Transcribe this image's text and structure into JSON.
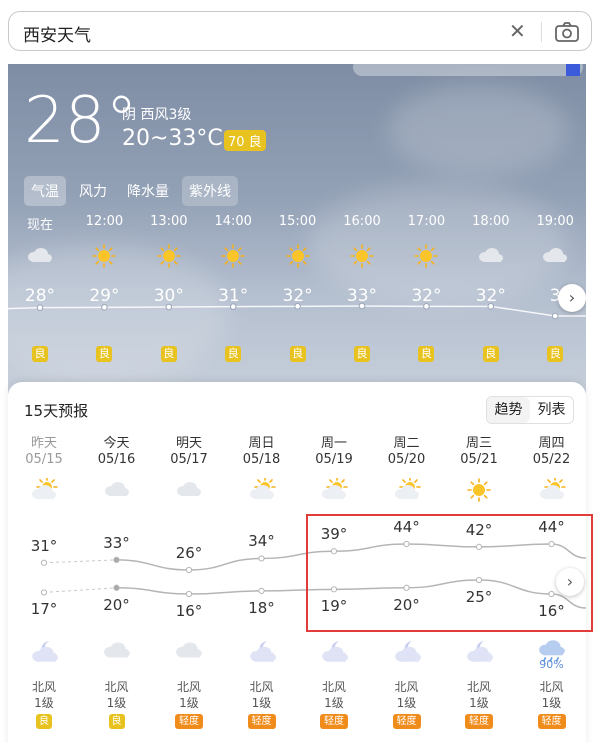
{
  "search": {
    "query": "西安天气"
  },
  "current": {
    "temp": "28°",
    "condition": "阴 西风3级",
    "range": "20~33°C",
    "aqi": "70 良"
  },
  "tabs": [
    "气温",
    "风力",
    "降水量",
    "紫外线"
  ],
  "hourly": [
    {
      "time": "现在",
      "icon": "cloud-icon",
      "temp": "28°",
      "aqi": "良"
    },
    {
      "time": "12:00",
      "icon": "sun-icon",
      "temp": "29°",
      "aqi": "良"
    },
    {
      "time": "13:00",
      "icon": "sun-icon",
      "temp": "30°",
      "aqi": "良"
    },
    {
      "time": "14:00",
      "icon": "sun-icon",
      "temp": "31°",
      "aqi": "良"
    },
    {
      "time": "15:00",
      "icon": "sun-icon",
      "temp": "32°",
      "aqi": "良"
    },
    {
      "time": "16:00",
      "icon": "sun-icon",
      "temp": "33°",
      "aqi": "良"
    },
    {
      "time": "17:00",
      "icon": "sun-icon",
      "temp": "32°",
      "aqi": "良"
    },
    {
      "time": "18:00",
      "icon": "cloud-icon",
      "temp": "32°",
      "aqi": "良"
    },
    {
      "time": "19:00",
      "icon": "cloud-icon",
      "temp": "3",
      "aqi": "良"
    }
  ],
  "forecast": {
    "title": "15天预报",
    "view_trend": "趋势",
    "view_list": "列表",
    "days": [
      {
        "name": "昨天",
        "date": "05/15",
        "icon": "partly-cloudy-icon",
        "hi": "31°",
        "lo": "17°",
        "night": "moon-cloud-icon",
        "precip": "",
        "wind": "北风",
        "level": "1级",
        "aqi": "良",
        "aqi_color": "#e8c21f",
        "past": true
      },
      {
        "name": "今天",
        "date": "05/16",
        "icon": "cloud-icon",
        "hi": "33°",
        "lo": "20°",
        "night": "cloud-icon",
        "precip": "",
        "wind": "北风",
        "level": "1级",
        "aqi": "良",
        "aqi_color": "#e8c21f",
        "past": false
      },
      {
        "name": "明天",
        "date": "05/17",
        "icon": "cloud-icon",
        "hi": "26°",
        "lo": "16°",
        "night": "cloud-icon",
        "precip": "",
        "wind": "北风",
        "level": "1级",
        "aqi": "轻度",
        "aqi_color": "#f08c1c",
        "past": false
      },
      {
        "name": "周日",
        "date": "05/18",
        "icon": "partly-cloudy-icon",
        "hi": "34°",
        "lo": "18°",
        "night": "moon-cloud-icon",
        "precip": "",
        "wind": "北风",
        "level": "1级",
        "aqi": "轻度",
        "aqi_color": "#f08c1c",
        "past": false
      },
      {
        "name": "周一",
        "date": "05/19",
        "icon": "partly-cloudy-icon",
        "hi": "39°",
        "lo": "19°",
        "night": "moon-cloud-icon",
        "precip": "",
        "wind": "北风",
        "level": "1级",
        "aqi": "轻度",
        "aqi_color": "#f08c1c",
        "past": false
      },
      {
        "name": "周二",
        "date": "05/20",
        "icon": "partly-cloudy-icon",
        "hi": "44°",
        "lo": "20°",
        "night": "moon-cloud-icon",
        "precip": "",
        "wind": "北风",
        "level": "1级",
        "aqi": "轻度",
        "aqi_color": "#f08c1c",
        "past": false
      },
      {
        "name": "周三",
        "date": "05/21",
        "icon": "sun-icon",
        "hi": "42°",
        "lo": "25°",
        "night": "moon-cloud-icon",
        "precip": "",
        "wind": "北风",
        "level": "1级",
        "aqi": "轻度",
        "aqi_color": "#f08c1c",
        "past": false
      },
      {
        "name": "周四",
        "date": "05/22",
        "icon": "partly-cloudy-icon",
        "hi": "44°",
        "lo": "16°",
        "night": "rain-cloud-icon",
        "precip": "90%",
        "wind": "北风",
        "level": "1级",
        "aqi": "轻度",
        "aqi_color": "#f08c1c",
        "past": false
      }
    ]
  }
}
